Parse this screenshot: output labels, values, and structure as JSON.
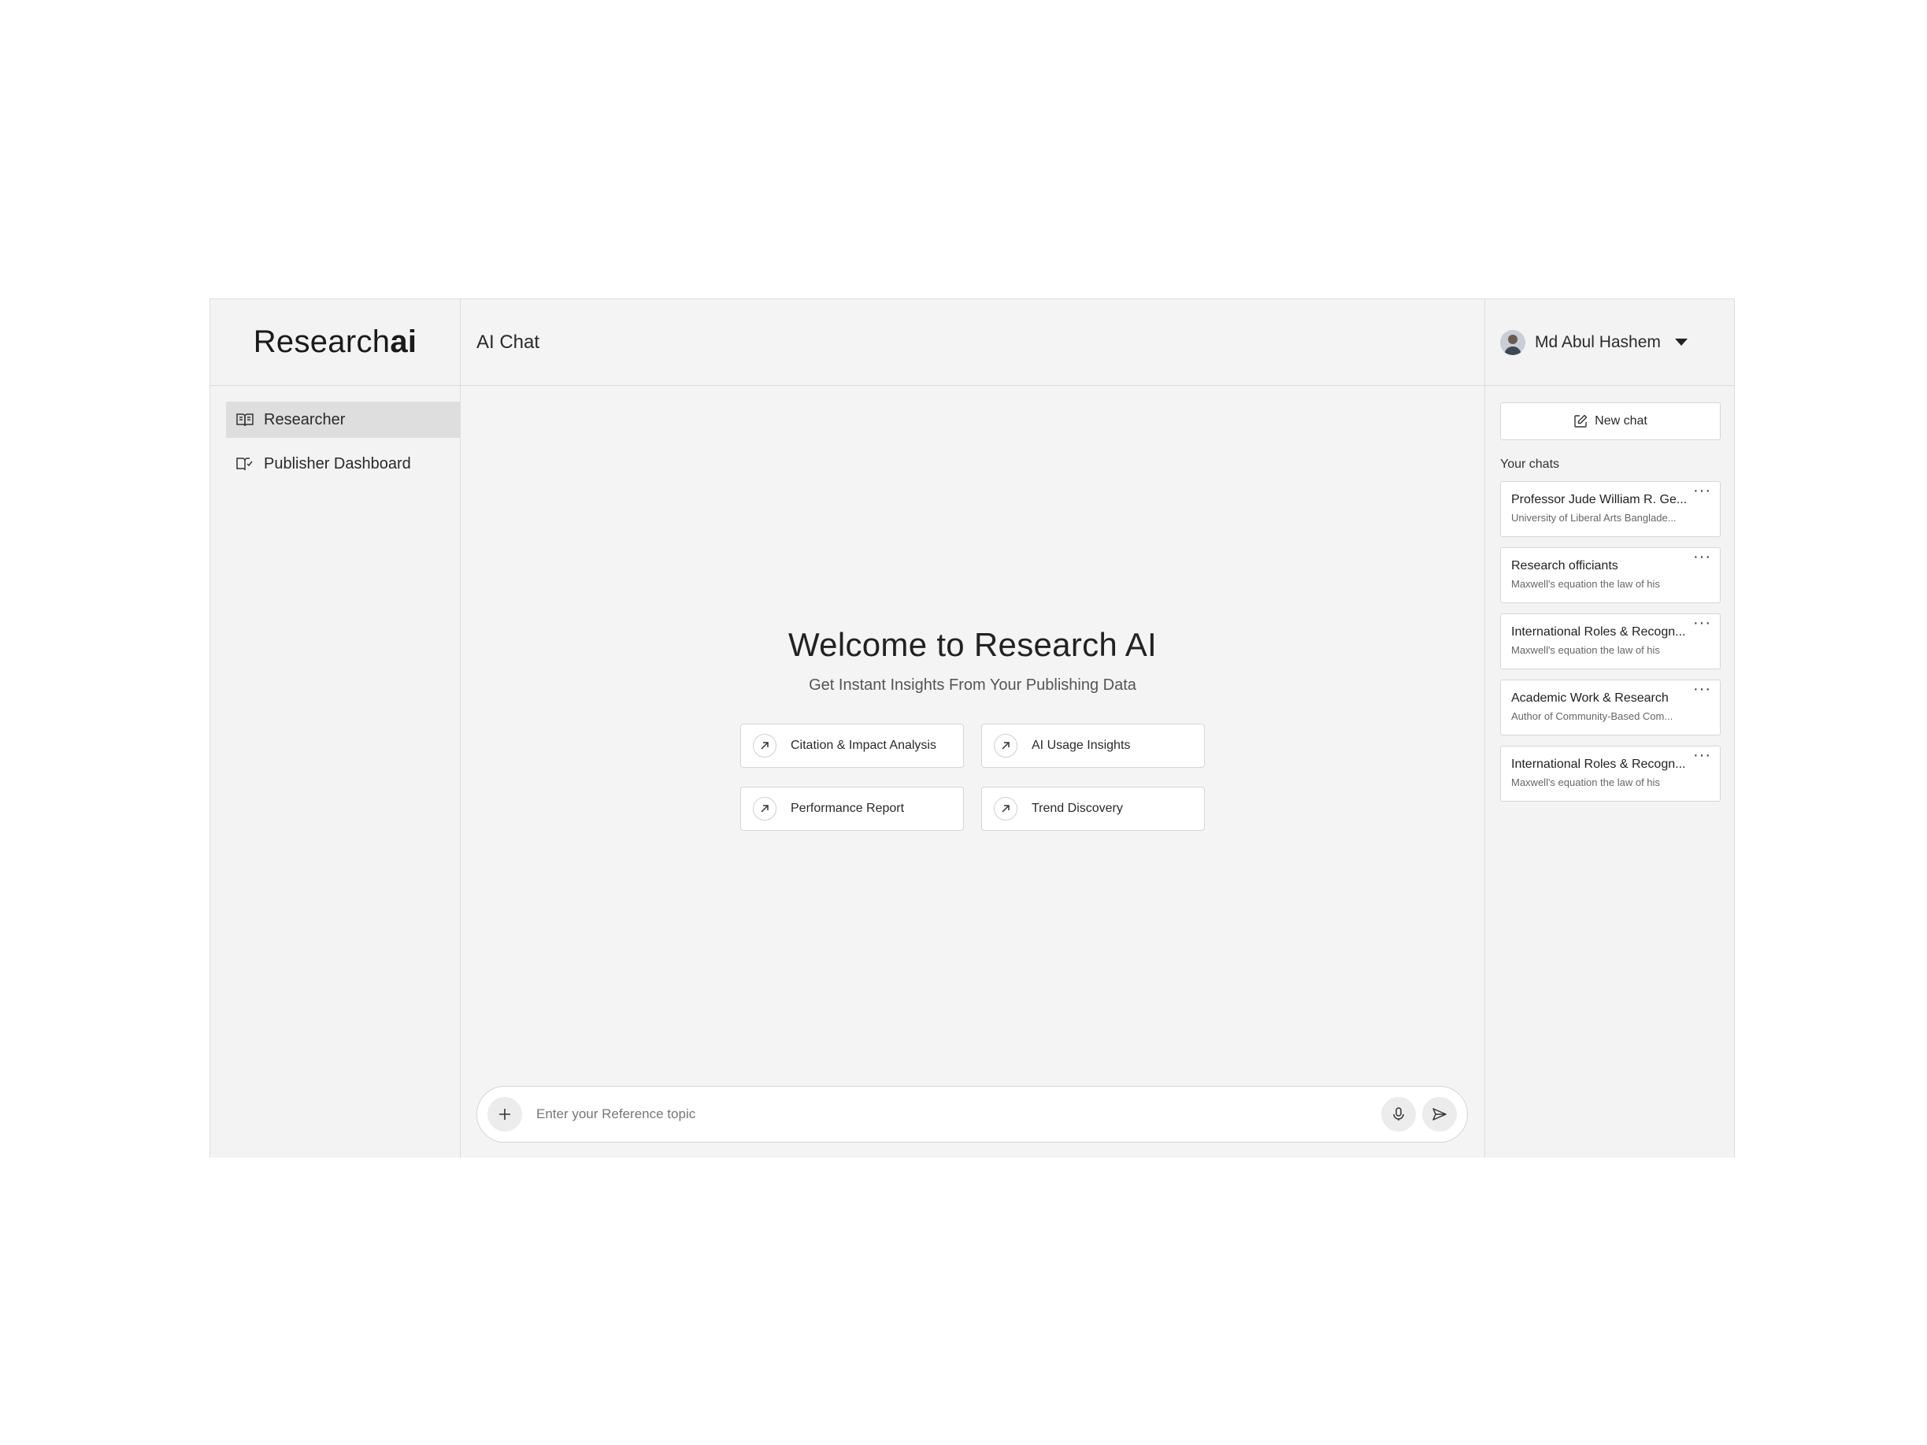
{
  "brand": {
    "prefix": "Research",
    "suffix": "ai"
  },
  "sidebar": {
    "items": [
      {
        "label": "Researcher",
        "icon": "open-book-icon",
        "active": true
      },
      {
        "label": "Publisher Dashboard",
        "icon": "book-check-icon",
        "active": false
      }
    ]
  },
  "header": {
    "title": "AI Chat"
  },
  "welcome": {
    "title": "Welcome to Research AI",
    "subtitle": "Get Instant Insights From Your Publishing Data"
  },
  "suggestions": [
    {
      "label": "Citation & Impact Analysis",
      "icon": "arrow-up-right-icon"
    },
    {
      "label": "AI Usage Insights",
      "icon": "arrow-up-right-icon"
    },
    {
      "label": "Performance Report",
      "icon": "arrow-up-right-icon"
    },
    {
      "label": "Trend Discovery",
      "icon": "arrow-up-right-icon"
    }
  ],
  "composer": {
    "placeholder": "Enter your Reference topic",
    "value": "",
    "icons": [
      "plus-icon",
      "microphone-icon",
      "send-icon"
    ]
  },
  "user": {
    "name": "Md Abul Hashem",
    "icon": "avatar"
  },
  "right_panel": {
    "new_chat_label": "New chat",
    "your_chats_label": "Your chats",
    "chats": [
      {
        "title": "Professor Jude William R. Ge...",
        "subtitle": "University of Liberal Arts Banglade..."
      },
      {
        "title": "Research officiants",
        "subtitle": "Maxwell's equation the law of his"
      },
      {
        "title": "International Roles & Recogn...",
        "subtitle": "Maxwell's equation the law of his"
      },
      {
        "title": "Academic Work & Research",
        "subtitle": "Author of Community-Based Com..."
      },
      {
        "title": "International Roles & Recogn...",
        "subtitle": "Maxwell's equation the law of his"
      }
    ]
  },
  "colors": {
    "background": "#ffffff",
    "app_bg": "#f4f4f4",
    "border": "#dcdcdc",
    "active_nav": "#dedede",
    "text": "#222222"
  }
}
